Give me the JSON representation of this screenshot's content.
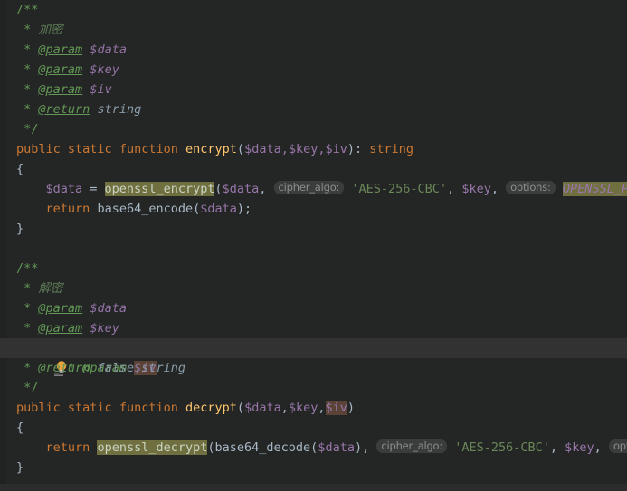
{
  "editor": {
    "language": "php",
    "theme": "darcula",
    "background": "#242625",
    "current_line_background": "#323232",
    "colors": {
      "keyword": "#cc7832",
      "function_name": "#ffc66d",
      "variable": "#9876aa",
      "string": "#6a8759",
      "comment": "#629755",
      "identifier": "#a9b7c6",
      "search_highlight": "#6f6f3f",
      "caret_identifier_highlight": "#5a4336",
      "inlay_hint_background": "#3b3d3c",
      "inlay_hint_text": "#8c8c8c"
    },
    "gutter": {
      "intention_bulb_icon": "lightbulb-icon",
      "intention_bulb_color": "#e8a33d",
      "intention_bulb_line": 18
    },
    "caret": {
      "line": 18,
      "after_text": "$iv"
    }
  },
  "doc_encrypt": {
    "open": "/**",
    "star": "*",
    "summary": "加密",
    "param_tag": "@param",
    "param_data": "$data",
    "param_key": "$key",
    "param_iv": "$iv",
    "return_tag": "@return",
    "return_type": "string",
    "close": "*/"
  },
  "doc_decrypt": {
    "open": "/**",
    "star": "*",
    "summary": "解密",
    "param_tag": "@param",
    "param_data": "$data",
    "param_key": "$key",
    "param_iv": "$iv",
    "return_tag": "@return",
    "return_type_false": "false",
    "return_type_pipe": "|",
    "return_type_string": "string",
    "close": "*/"
  },
  "fn_encrypt": {
    "kw_public": "public",
    "kw_static": "static",
    "kw_function": "function",
    "name": "encrypt",
    "sig_open": "(",
    "sig_args": "$data,$key,$iv",
    "sig_close": ")",
    "sig_colon": ": ",
    "return_type": "string",
    "brace_open": "{",
    "brace_close": "}",
    "body": {
      "assign_var": "$data",
      "assign_op": " = ",
      "call_name": "openssl_encrypt",
      "call_open": "(",
      "arg_data": "$data",
      "comma1": ", ",
      "hint_cipher": "cipher_algo:",
      "arg_algo": "'AES-256-CBC'",
      "comma2": ", ",
      "arg_key": "$key",
      "comma3": ", ",
      "hint_options": "options:",
      "arg_options": "OPENSSL_PK",
      "return_kw": "return",
      "return_call": "base64_encode",
      "return_arg": "$data",
      "return_end": ");"
    }
  },
  "fn_decrypt": {
    "kw_public": "public",
    "kw_static": "static",
    "kw_function": "function",
    "name": "decrypt",
    "sig_open": "(",
    "sig_arg_data": "$data",
    "sig_comma1": ",",
    "sig_arg_key": "$key",
    "sig_comma2": ",",
    "sig_arg_iv": "$iv",
    "sig_close": ")",
    "brace_open": "{",
    "brace_close": "}",
    "body": {
      "return_kw": "return",
      "call_name": "openssl_decrypt",
      "call_open": "(",
      "inner_call": "base64_decode",
      "inner_open": "(",
      "inner_arg": "$data",
      "inner_close": ")",
      "comma1": ", ",
      "hint_cipher": "cipher_algo:",
      "arg_algo": "'AES-256-CBC'",
      "comma2": ", ",
      "arg_key": "$key",
      "comma3": ", ",
      "hint_options": "opti"
    }
  }
}
